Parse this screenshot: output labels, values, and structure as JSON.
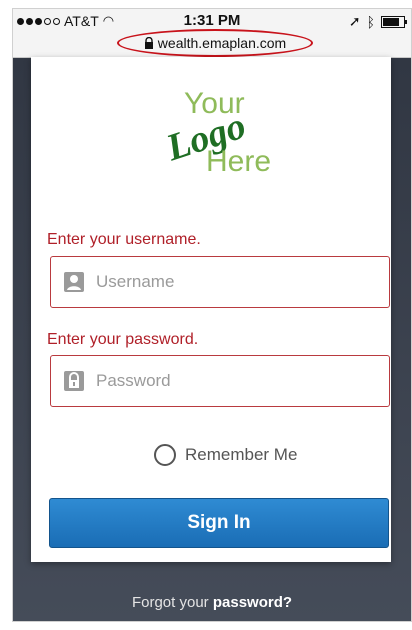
{
  "status_bar": {
    "carrier": "AT&T",
    "time": "1:31 PM",
    "url": "wealth.emaplan.com"
  },
  "logo": {
    "line1": "Your",
    "line2": "Logo",
    "line3": "Here"
  },
  "form": {
    "username_label": "Enter your username.",
    "username_placeholder": "Username",
    "password_label": "Enter your password.",
    "password_placeholder": "Password",
    "remember_label": "Remember Me",
    "signin_label": "Sign In"
  },
  "footer": {
    "forgot_prefix": "Forgot your",
    "forgot_bold": "password?"
  },
  "colors": {
    "error_red": "#b02029",
    "primary_blue": "#1a6db5",
    "logo_green": "#1f6e24"
  }
}
